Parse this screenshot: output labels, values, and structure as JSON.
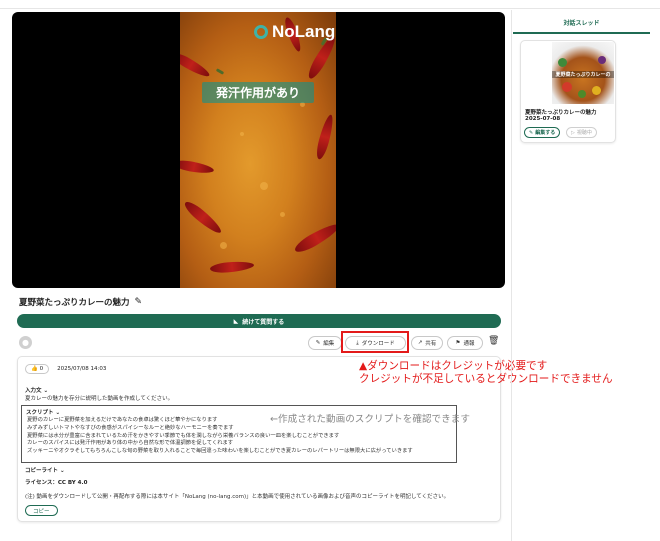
{
  "video": {
    "brand": "NoLang",
    "caption": "発汗作用があり"
  },
  "video_title": "夏野菜たっぷりカレーの魅力",
  "continue_button": "続けて質問する",
  "actions": {
    "edit": "編集",
    "download": "ダウンロード",
    "share": "共有",
    "report": "通報"
  },
  "annotations": {
    "download_note_1": "▲ダウンロードはクレジットが必要です",
    "download_note_2": "クレジットが不足しているとダウンロードできません",
    "script_note": "←作成された動画のスクリプトを確認できます"
  },
  "info": {
    "likes": "0",
    "datetime": "2025/07/08 14:03",
    "input_label": "入力文",
    "input_text": "夏カレーの魅力を存分に説明した動画を作成してください。",
    "script_label": "スクリプト",
    "script_lines": [
      "夏野のカレーに夏野菜を加えるだけであなたの食卓は驚くほど華やかになります",
      "みずみずしいトマトやなすびの食感がスパイシーなルーと絶妙なハーモニーを奏でます",
      "夏野菜には水分が豊富に含まれているため汗をかきやすい季節でも体を潤しながら栄養バランスの良い一皿を楽しむことができます",
      "カレーのスパイスには発汗作用があり体の中から自然な形で体温調節を促してくれます",
      "ズッキーニやオクラそしてもちろんこしな旬の野菜を取り入れることで毎回違った味わいを楽しむことができ夏カレーのレパートリーは無限大に広がっていきます"
    ],
    "copyright_label": "コピーライト",
    "license": "ライセンス：CC BY 4.0",
    "notice": "(注) 動画をダウンロードして公開・再配布する際には本サイト「NoLang (no-lang.com)」と本動画で使用されている画像および音声のコピーライトを明記してください。",
    "copy_button": "コピー"
  },
  "panel": {
    "title": "対話スレッド",
    "thread": {
      "thumb_caption": "夏野菜たっぷりカレーの",
      "title": "夏野菜たっぷりカレーの魅力",
      "date": "2025-07-08",
      "edit_button": "編集する",
      "play_button": "視聴中"
    }
  },
  "colors": {
    "accent": "#1f6b53",
    "highlight": "#e31a1a"
  }
}
